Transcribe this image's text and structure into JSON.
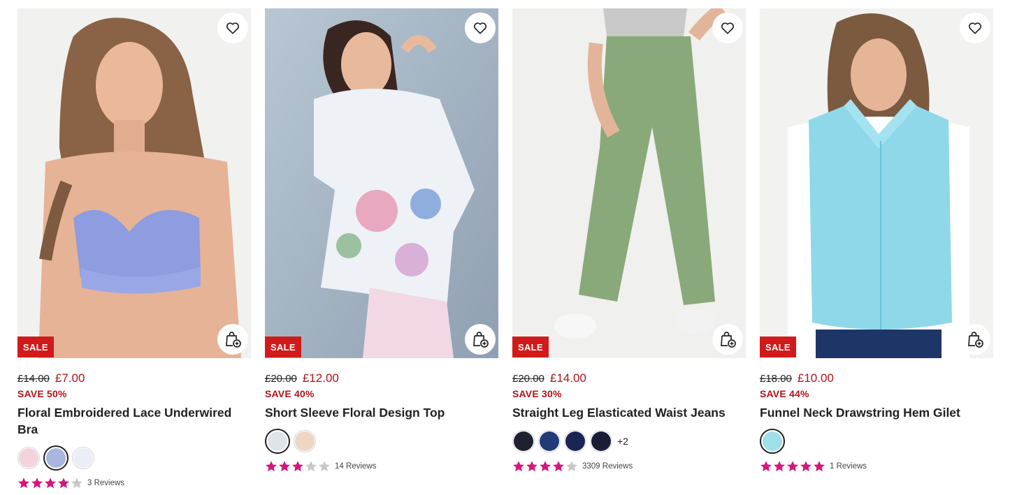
{
  "colors": {
    "sale_red": "#d11a1a",
    "price_red": "#b3121a",
    "star_on": "#d6157d",
    "star_off": "#c8c8c8"
  },
  "products": [
    {
      "badge": "SALE",
      "was": "£14.00",
      "now": "£7.00",
      "save": "SAVE 50%",
      "title": "Floral Embroidered Lace Underwired Bra",
      "swatches": [
        "#f4d3dc",
        "#a8b6e0",
        "#eceef6"
      ],
      "selected_swatch": 1,
      "more": "",
      "rating": 4,
      "reviews": "3 Reviews"
    },
    {
      "badge": "SALE",
      "was": "£20.00",
      "now": "£12.00",
      "save": "SAVE 40%",
      "title": "Short Sleeve Floral Design Top",
      "swatches": [
        "#dfe4e8",
        "#eed6c4"
      ],
      "selected_swatch": 0,
      "more": "",
      "rating": 3,
      "reviews": "14 Reviews"
    },
    {
      "badge": "SALE",
      "was": "£20.00",
      "now": "£14.00",
      "save": "SAVE 30%",
      "title": "Straight Leg Elasticated Waist Jeans",
      "swatches": [
        "#1e2230",
        "#223a78",
        "#1b2554",
        "#1a1d35"
      ],
      "selected_swatch": -1,
      "more": "+2",
      "rating": 4,
      "reviews": "3309 Reviews"
    },
    {
      "badge": "SALE",
      "was": "£18.00",
      "now": "£10.00",
      "save": "SAVE 44%",
      "title": "Funnel Neck Drawstring Hem Gilet",
      "swatches": [
        "#9fdfea"
      ],
      "selected_swatch": 0,
      "more": "",
      "rating": 5,
      "reviews": "1 Reviews"
    }
  ]
}
